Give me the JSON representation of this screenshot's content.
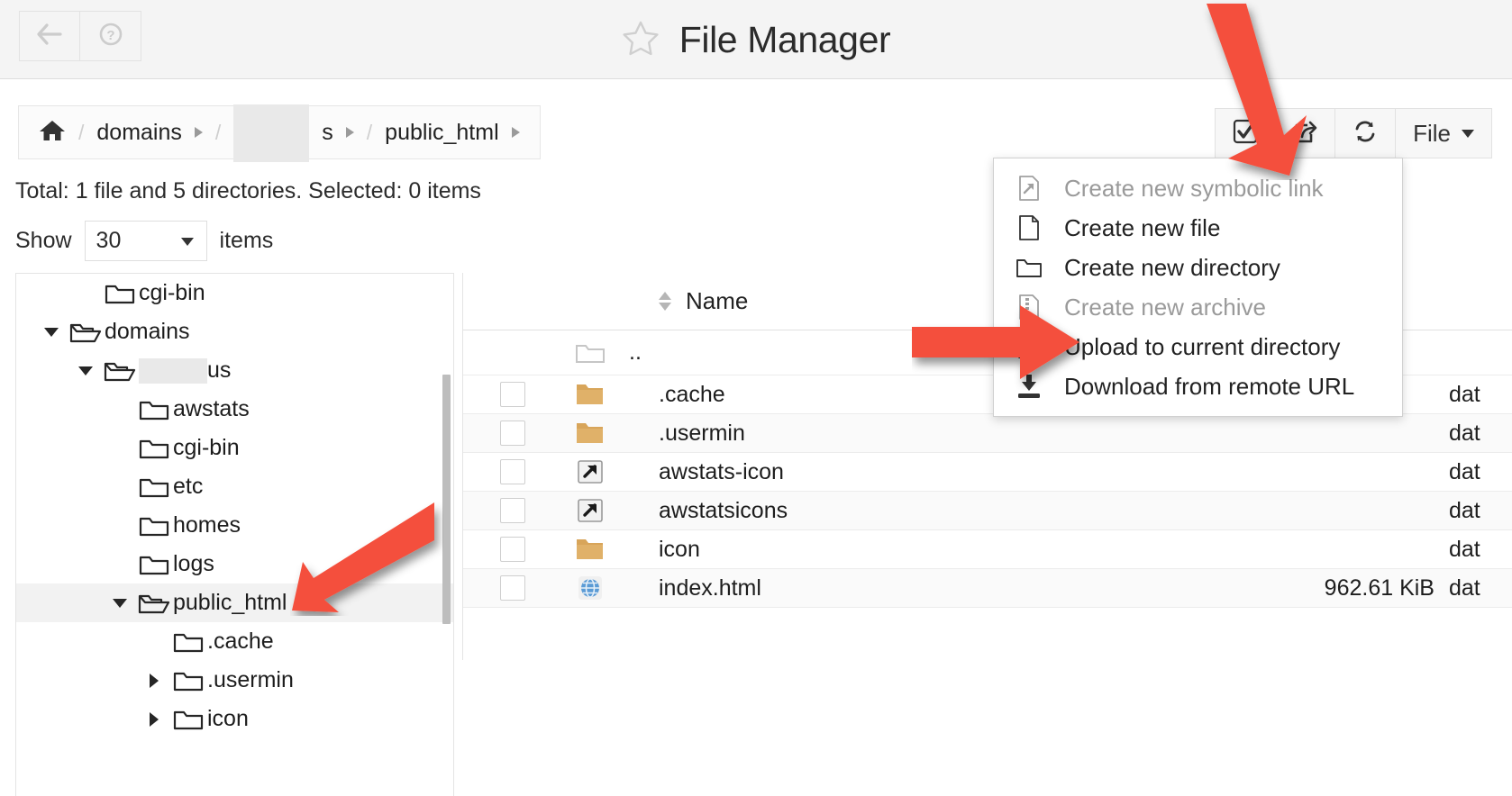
{
  "header": {
    "title": "File Manager",
    "star_icon": "star-icon",
    "back_icon": "back-arrow-icon",
    "help_icon": "help-question-icon"
  },
  "breadcrumb": {
    "home_icon": "home-icon",
    "items": [
      {
        "label": "domains",
        "redacted": false
      },
      {
        "label": "s",
        "redacted": true
      },
      {
        "label": "public_html",
        "redacted": false
      }
    ],
    "separator": "/"
  },
  "toolbar": {
    "select_all_icon": "checkbox-checked-icon",
    "share_icon": "share-external-icon",
    "refresh_icon": "refresh-sync-icon",
    "file_label": "File",
    "file_caret_icon": "chevron-down-icon"
  },
  "status": {
    "total_text": "Total: 1 file and 5 directories. Selected: 0 items"
  },
  "pagination": {
    "show_label": "Show",
    "page_size": "30",
    "items_label": "items",
    "caret_icon": "chevron-down-icon"
  },
  "tree": {
    "nodes": [
      {
        "label": "cgi-bin",
        "depth": 1,
        "toggle": "none",
        "icon": "folder-closed-icon",
        "selected": false,
        "redacted": false
      },
      {
        "label": "domains",
        "depth": 0,
        "toggle": "down",
        "icon": "folder-open-icon",
        "selected": false,
        "redacted": false
      },
      {
        "label": "us",
        "depth": 1,
        "toggle": "down",
        "icon": "folder-open-icon",
        "selected": false,
        "redacted": true
      },
      {
        "label": "awstats",
        "depth": 2,
        "toggle": "none",
        "icon": "folder-closed-icon",
        "selected": false,
        "redacted": false
      },
      {
        "label": "cgi-bin",
        "depth": 2,
        "toggle": "none",
        "icon": "folder-closed-icon",
        "selected": false,
        "redacted": false
      },
      {
        "label": "etc",
        "depth": 2,
        "toggle": "none",
        "icon": "folder-closed-icon",
        "selected": false,
        "redacted": false
      },
      {
        "label": "homes",
        "depth": 2,
        "toggle": "none",
        "icon": "folder-closed-icon",
        "selected": false,
        "redacted": false
      },
      {
        "label": "logs",
        "depth": 2,
        "toggle": "none",
        "icon": "folder-closed-icon",
        "selected": false,
        "redacted": false
      },
      {
        "label": "public_html",
        "depth": 2,
        "toggle": "down",
        "icon": "folder-open-icon",
        "selected": true,
        "redacted": false
      },
      {
        "label": ".cache",
        "depth": 3,
        "toggle": "none",
        "icon": "folder-closed-icon",
        "selected": false,
        "redacted": false
      },
      {
        "label": ".usermin",
        "depth": 3,
        "toggle": "right",
        "icon": "folder-closed-icon",
        "selected": false,
        "redacted": false
      },
      {
        "label": "icon",
        "depth": 3,
        "toggle": "right",
        "icon": "folder-closed-icon",
        "selected": false,
        "redacted": false
      }
    ],
    "scrollbar": "vertical-scrollbar"
  },
  "table": {
    "columns": {
      "name": "Name",
      "size_partial": "",
      "date_partial": "dat"
    },
    "sort_icon": "sort-updown-icon",
    "parent_row": {
      "name": "..",
      "icon": "folder-outline-icon"
    },
    "rows": [
      {
        "name": ".cache",
        "icon": "folder-filled-icon",
        "size": "",
        "date": "dat"
      },
      {
        "name": ".usermin",
        "icon": "folder-filled-icon",
        "size": "",
        "date": "dat"
      },
      {
        "name": "awstats-icon",
        "icon": "symlink-icon",
        "size": "",
        "date": "dat"
      },
      {
        "name": "awstatsicons",
        "icon": "symlink-icon",
        "size": "",
        "date": "dat"
      },
      {
        "name": "icon",
        "icon": "folder-filled-icon",
        "size": "",
        "date": "dat"
      },
      {
        "name": "index.html",
        "icon": "globe-html-icon",
        "size": "962.61 KiB",
        "date": "dat"
      }
    ]
  },
  "menu": {
    "items": [
      {
        "label": "Create new symbolic link",
        "icon": "symlink-file-icon",
        "disabled": true
      },
      {
        "label": "Create new file",
        "icon": "blank-file-icon",
        "disabled": false
      },
      {
        "label": "Create new directory",
        "icon": "folder-icon",
        "disabled": false
      },
      {
        "label": "Create new archive",
        "icon": "archive-file-icon",
        "disabled": true
      },
      {
        "label": "Upload to current directory",
        "icon": "upload-icon",
        "disabled": false
      },
      {
        "label": "Download from remote URL",
        "icon": "download-icon",
        "disabled": false
      }
    ]
  },
  "annotations": {
    "arrow_color": "#f4503c",
    "arrows": [
      {
        "target": "file-dropdown-button"
      },
      {
        "target": "upload-to-current-directory-menu-item"
      },
      {
        "target": "tree-item-public_html"
      }
    ]
  }
}
